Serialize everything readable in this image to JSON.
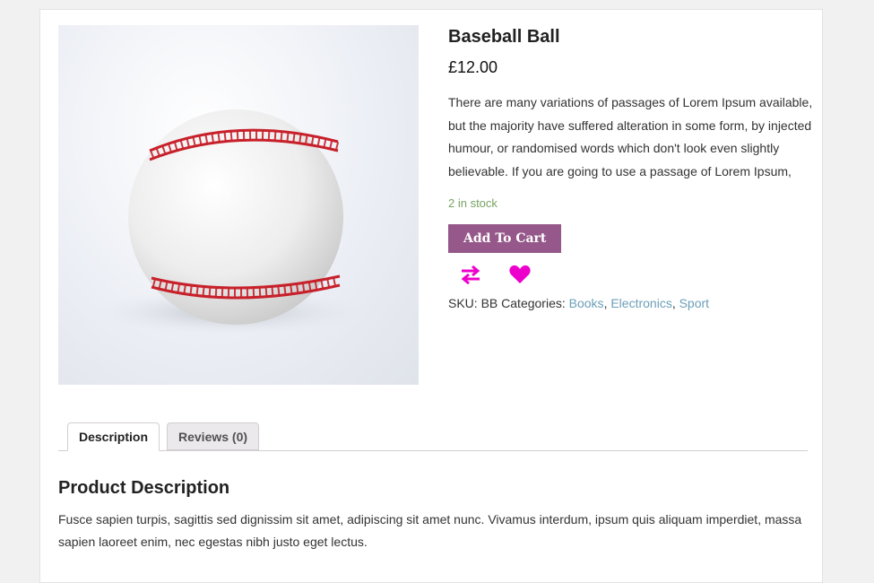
{
  "product": {
    "title": "Baseball Ball",
    "price": "£12.00",
    "short_description": "There are many variations of passages of Lorem Ipsum available, but the majority have suffered alteration in some form, by injected humour, or randomised words which don't look even slightly believable. If you are going to use a passage of Lorem Ipsum,",
    "stock": "2 in stock",
    "add_to_cart_label": "Add To Cart",
    "sku_label": "SKU:",
    "sku": "BB",
    "categories_label": "Categories:",
    "categories": [
      "Books",
      "Electronics",
      "Sport"
    ],
    "image_icon": "baseball-image"
  },
  "actions": {
    "compare_icon": "compare-arrows-icon",
    "wishlist_icon": "heart-icon",
    "icon_color": "#ee00cc"
  },
  "tabs": [
    {
      "label": "Description",
      "active": true
    },
    {
      "label": "Reviews (0)",
      "active": false
    }
  ],
  "description_panel": {
    "heading": "Product Description",
    "text": "Fusce sapien turpis, sagittis sed dignissim sit amet, adipiscing sit amet nunc. Vivamus interdum, ipsum quis aliquam imperdiet, massa sapien laoreet enim, nec egestas nibh justo eget lectus."
  },
  "colors": {
    "button": "#96588a",
    "stock": "#77a464",
    "link": "#6b9fb8"
  }
}
